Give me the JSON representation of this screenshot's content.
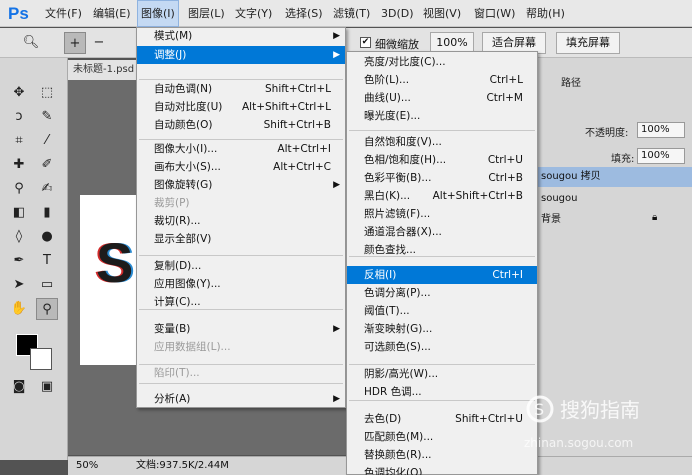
{
  "app": {
    "logo": "Ps",
    "brand_color": "#1473e6"
  },
  "menubar": [
    {
      "label": "文件(F)"
    },
    {
      "label": "编辑(E)"
    },
    {
      "label": "图像(I)"
    },
    {
      "label": "图层(L)"
    },
    {
      "label": "文字(Y)"
    },
    {
      "label": "选择(S)"
    },
    {
      "label": "滤镜(T)"
    },
    {
      "label": "3D(D)"
    },
    {
      "label": "视图(V)"
    },
    {
      "label": "窗口(W)"
    },
    {
      "label": "帮助(H)"
    }
  ],
  "options_bar": {
    "fine_zoom_label": "细微缩放",
    "zoom_value": "100%",
    "fit_screen": "适合屏幕",
    "fill_screen": "填充屏幕"
  },
  "document": {
    "tab_title": "未标题-1.psd",
    "canvas_letter": "S"
  },
  "status": {
    "zoom": "50%",
    "doc_info": "文档:937.5K/2.44M"
  },
  "right_panel": {
    "tab_path": "路径",
    "opacity_label": "不透明度:",
    "opacity_value": "100%",
    "fill_label": "填充:",
    "fill_value": "100%",
    "layers": [
      "sougou 拷贝",
      "sougou",
      "背景"
    ]
  },
  "image_menu": [
    {
      "label": "模式(M)",
      "shortcut": "",
      "sub": true
    },
    {
      "label": "调整(J)",
      "shortcut": "",
      "sub": true,
      "highlight": true
    },
    {
      "label": "自动色调(N)",
      "shortcut": "Shift+Ctrl+L"
    },
    {
      "label": "自动对比度(U)",
      "shortcut": "Alt+Shift+Ctrl+L"
    },
    {
      "label": "自动颜色(O)",
      "shortcut": "Shift+Ctrl+B"
    },
    {
      "label": "图像大小(I)...",
      "shortcut": "Alt+Ctrl+I"
    },
    {
      "label": "画布大小(S)...",
      "shortcut": "Alt+Ctrl+C"
    },
    {
      "label": "图像旋转(G)",
      "shortcut": "",
      "sub": true
    },
    {
      "label": "裁剪(P)",
      "shortcut": "",
      "disabled": true
    },
    {
      "label": "裁切(R)...",
      "shortcut": ""
    },
    {
      "label": "显示全部(V)",
      "shortcut": ""
    },
    {
      "label": "复制(D)...",
      "shortcut": ""
    },
    {
      "label": "应用图像(Y)...",
      "shortcut": ""
    },
    {
      "label": "计算(C)...",
      "shortcut": ""
    },
    {
      "label": "变量(B)",
      "shortcut": "",
      "sub": true
    },
    {
      "label": "应用数据组(L)...",
      "shortcut": "",
      "disabled": true
    },
    {
      "label": "陷印(T)...",
      "shortcut": "",
      "disabled": true
    },
    {
      "label": "分析(A)",
      "shortcut": "",
      "sub": true
    }
  ],
  "adjust_menu": [
    {
      "label": "亮度/对比度(C)...",
      "shortcut": ""
    },
    {
      "label": "色阶(L)...",
      "shortcut": "Ctrl+L"
    },
    {
      "label": "曲线(U)...",
      "shortcut": "Ctrl+M"
    },
    {
      "label": "曝光度(E)...",
      "shortcut": ""
    },
    {
      "label": "自然饱和度(V)...",
      "shortcut": ""
    },
    {
      "label": "色相/饱和度(H)...",
      "shortcut": "Ctrl+U"
    },
    {
      "label": "色彩平衡(B)...",
      "shortcut": "Ctrl+B"
    },
    {
      "label": "黑白(K)...",
      "shortcut": "Alt+Shift+Ctrl+B"
    },
    {
      "label": "照片滤镜(F)...",
      "shortcut": ""
    },
    {
      "label": "通道混合器(X)...",
      "shortcut": ""
    },
    {
      "label": "颜色查找...",
      "shortcut": ""
    },
    {
      "label": "反相(I)",
      "shortcut": "Ctrl+I",
      "highlight": true
    },
    {
      "label": "色调分离(P)...",
      "shortcut": ""
    },
    {
      "label": "阈值(T)...",
      "shortcut": ""
    },
    {
      "label": "渐变映射(G)...",
      "shortcut": ""
    },
    {
      "label": "可选颜色(S)...",
      "shortcut": ""
    },
    {
      "label": "阴影/高光(W)...",
      "shortcut": ""
    },
    {
      "label": "HDR 色调...",
      "shortcut": ""
    },
    {
      "label": "去色(D)",
      "shortcut": "Shift+Ctrl+U"
    },
    {
      "label": "匹配颜色(M)...",
      "shortcut": ""
    },
    {
      "label": "替换颜色(R)...",
      "shortcut": ""
    },
    {
      "label": "色调均化(Q)",
      "shortcut": ""
    }
  ],
  "watermark": {
    "brand": "搜狗指南",
    "url": "zhinan.sogou.com"
  }
}
